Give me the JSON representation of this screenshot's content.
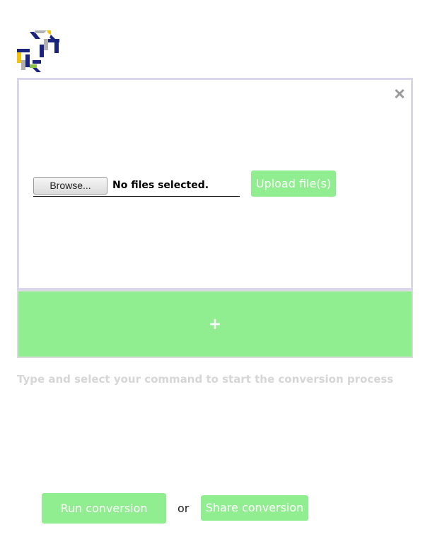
{
  "logo": {
    "icon": "app-logo",
    "colors": [
      "#1a237e",
      "#f4c20d",
      "#8bc34a",
      "#b0b0b0"
    ]
  },
  "upload_panel": {
    "close_icon": "close-icon",
    "browse_label": "Browse...",
    "file_status": "No files selected.",
    "upload_label": "Upload file(s)"
  },
  "add_command": {
    "label": "+"
  },
  "command_hint": "Type and select your command to start the conversion process",
  "actions": {
    "run_label": "Run conversion",
    "or_label": "or",
    "share_label": "Share conversion"
  },
  "theme": {
    "accent": "#90ee90",
    "panel_border": "#d7d6ec",
    "hint_text": "#d6d6d6"
  }
}
